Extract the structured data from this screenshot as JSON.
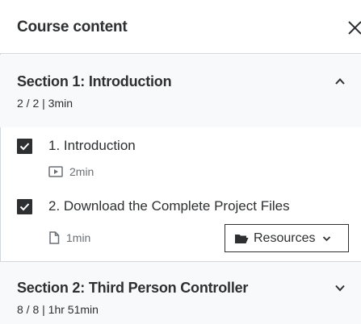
{
  "header": {
    "title": "Course content"
  },
  "sections": [
    {
      "title": "Section 1: Introduction",
      "meta": "2 / 2 | 3min",
      "expanded": true,
      "items": [
        {
          "title": "1. Introduction",
          "checked": true,
          "type_icon": "video-icon",
          "duration": "2min"
        },
        {
          "title": "2. Download the Complete Project Files",
          "checked": true,
          "type_icon": "file-icon",
          "duration": "1min",
          "resources_label": "Resources"
        }
      ]
    },
    {
      "title": "Section 2: Third Person Controller",
      "meta": "8 / 8 | 1hr 51min",
      "expanded": false
    }
  ]
}
